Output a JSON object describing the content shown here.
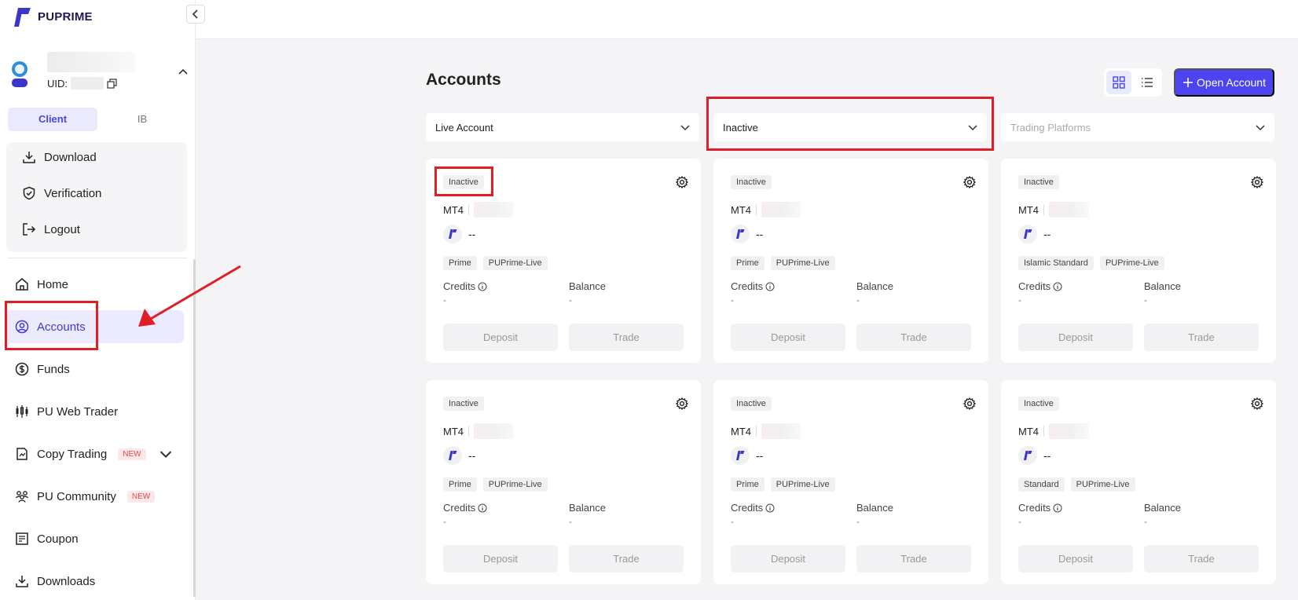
{
  "brand": {
    "name": "PUPRIME",
    "color": "#1e1a4d"
  },
  "accent": "#4b44ef",
  "highlight_color": "#e01e25",
  "profile": {
    "uid_label": "UID:"
  },
  "role_tabs": [
    {
      "label": "Client",
      "active": true
    },
    {
      "label": "IB",
      "active": false
    }
  ],
  "profile_menu": [
    {
      "label": "Download",
      "icon": "download-icon"
    },
    {
      "label": "Verification",
      "icon": "shield-check-icon"
    },
    {
      "label": "Logout",
      "icon": "logout-icon"
    }
  ],
  "nav": [
    {
      "label": "Home",
      "icon": "home-icon"
    },
    {
      "label": "Accounts",
      "icon": "user-circle-icon",
      "active": true
    },
    {
      "label": "Funds",
      "icon": "dollar-circle-icon"
    },
    {
      "label": "PU Web Trader",
      "icon": "candlestick-icon"
    },
    {
      "label": "Copy Trading",
      "icon": "copy-trading-icon",
      "badge": "NEW",
      "expandable": true
    },
    {
      "label": "PU Community",
      "icon": "community-icon",
      "badge": "NEW"
    },
    {
      "label": "Coupon",
      "icon": "coupon-icon"
    },
    {
      "label": "Downloads",
      "icon": "download-icon"
    }
  ],
  "main": {
    "title": "Accounts",
    "open_account_label": "Open Account",
    "filters": [
      {
        "value": "Live Account",
        "placeholder": false
      },
      {
        "value": "Inactive",
        "placeholder": false
      },
      {
        "value": "Trading Platforms",
        "placeholder": true
      }
    ]
  },
  "cards": [
    {
      "status": "Inactive",
      "platform": "MT4",
      "pu_value": "--",
      "tags": [
        "Prime",
        "PUPrime-Live"
      ],
      "credits_label": "Credits",
      "credits_value": "-",
      "balance_label": "Balance",
      "balance_value": "-",
      "deposit_label": "Deposit",
      "trade_label": "Trade"
    },
    {
      "status": "Inactive",
      "platform": "MT4",
      "pu_value": "--",
      "tags": [
        "Prime",
        "PUPrime-Live"
      ],
      "credits_label": "Credits",
      "credits_value": "-",
      "balance_label": "Balance",
      "balance_value": "-",
      "deposit_label": "Deposit",
      "trade_label": "Trade"
    },
    {
      "status": "Inactive",
      "platform": "MT4",
      "pu_value": "--",
      "tags": [
        "Islamic Standard",
        "PUPrime-Live"
      ],
      "credits_label": "Credits",
      "credits_value": "-",
      "balance_label": "Balance",
      "balance_value": "-",
      "deposit_label": "Deposit",
      "trade_label": "Trade"
    },
    {
      "status": "Inactive",
      "platform": "MT4",
      "pu_value": "--",
      "tags": [
        "Prime",
        "PUPrime-Live"
      ],
      "credits_label": "Credits",
      "credits_value": "-",
      "balance_label": "Balance",
      "balance_value": "-",
      "deposit_label": "Deposit",
      "trade_label": "Trade"
    },
    {
      "status": "Inactive",
      "platform": "MT4",
      "pu_value": "--",
      "tags": [
        "Prime",
        "PUPrime-Live"
      ],
      "credits_label": "Credits",
      "credits_value": "-",
      "balance_label": "Balance",
      "balance_value": "-",
      "deposit_label": "Deposit",
      "trade_label": "Trade"
    },
    {
      "status": "Inactive",
      "platform": "MT4",
      "pu_value": "--",
      "tags": [
        "Standard",
        "PUPrime-Live"
      ],
      "credits_label": "Credits",
      "credits_value": "-",
      "balance_label": "Balance",
      "balance_value": "-",
      "deposit_label": "Deposit",
      "trade_label": "Trade"
    }
  ]
}
